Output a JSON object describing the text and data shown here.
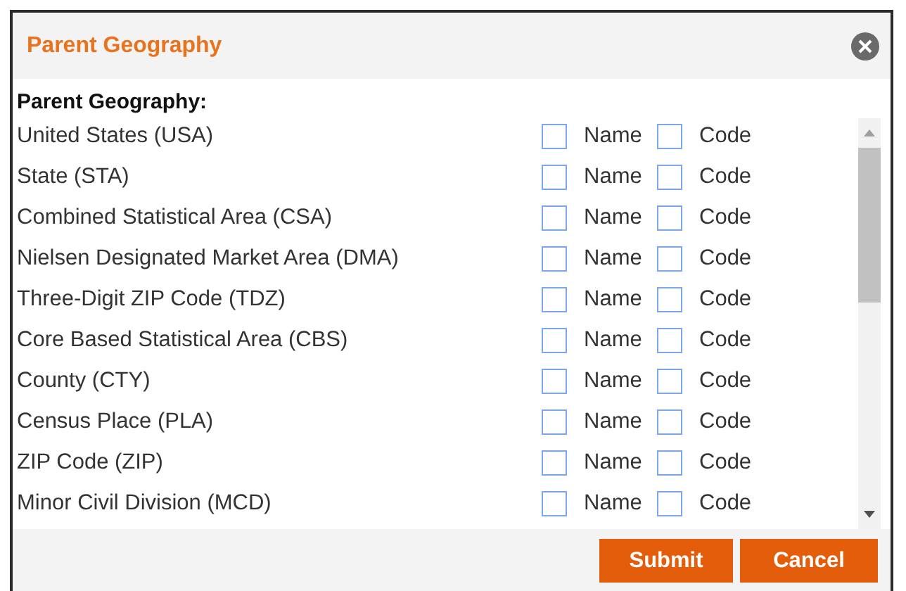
{
  "dialog": {
    "title": "Parent Geography"
  },
  "section_label": "Parent Geography:",
  "rows": [
    {
      "geography": "United States (USA)",
      "name_label": "Name",
      "name_checked": false,
      "code_label": "Code",
      "code_checked": false
    },
    {
      "geography": "State (STA)",
      "name_label": "Name",
      "name_checked": false,
      "code_label": "Code",
      "code_checked": false
    },
    {
      "geography": "Combined Statistical Area (CSA)",
      "name_label": "Name",
      "name_checked": false,
      "code_label": "Code",
      "code_checked": false
    },
    {
      "geography": "Nielsen Designated Market Area (DMA)",
      "name_label": "Name",
      "name_checked": false,
      "code_label": "Code",
      "code_checked": false
    },
    {
      "geography": "Three-Digit ZIP Code (TDZ)",
      "name_label": "Name",
      "name_checked": false,
      "code_label": "Code",
      "code_checked": false
    },
    {
      "geography": "Core Based Statistical Area (CBS)",
      "name_label": "Name",
      "name_checked": false,
      "code_label": "Code",
      "code_checked": false
    },
    {
      "geography": "County (CTY)",
      "name_label": "Name",
      "name_checked": false,
      "code_label": "Code",
      "code_checked": false
    },
    {
      "geography": "Census Place (PLA)",
      "name_label": "Name",
      "name_checked": false,
      "code_label": "Code",
      "code_checked": false
    },
    {
      "geography": "ZIP Code (ZIP)",
      "name_label": "Name",
      "name_checked": false,
      "code_label": "Code",
      "code_checked": false
    },
    {
      "geography": "Minor Civil Division (MCD)",
      "name_label": "Name",
      "name_checked": false,
      "code_label": "Code",
      "code_checked": false
    }
  ],
  "buttons": [
    {
      "label": "Submit"
    },
    {
      "label": "Cancel"
    }
  ]
}
